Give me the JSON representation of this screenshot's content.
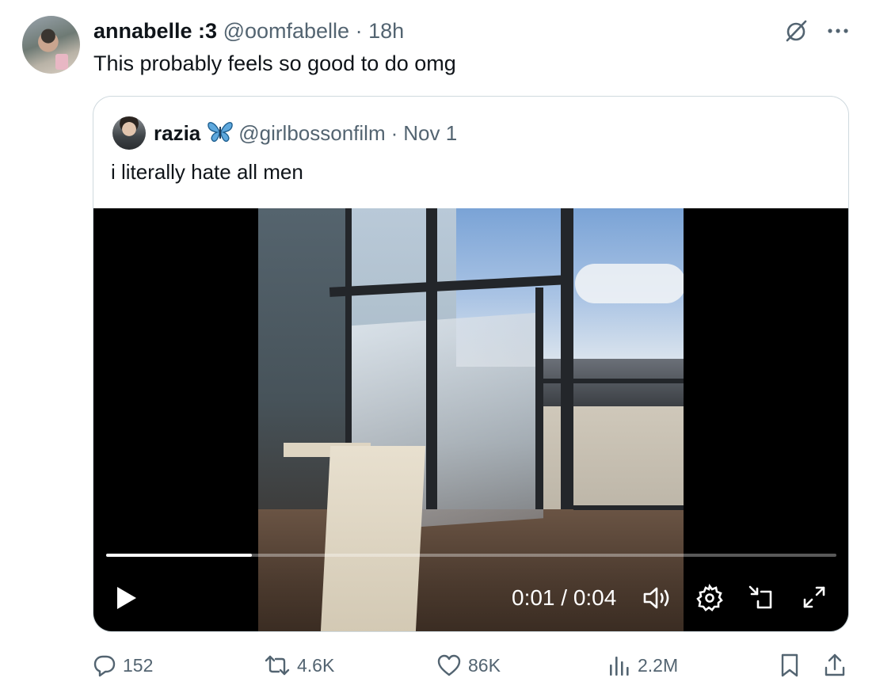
{
  "tweet": {
    "display_name": "annabelle :3",
    "handle": "@oomfabelle",
    "separator": "·",
    "time": "18h",
    "text": "This probably feels so good to do omg"
  },
  "quoted_tweet": {
    "display_name": "razia",
    "badge_emoji_icon": "butterfly-icon",
    "handle": "@girlbossonfilm",
    "separator": "·",
    "date": "Nov 1",
    "text": "i literally hate all men"
  },
  "video": {
    "time_display": "0:01 / 0:04",
    "progress_fraction": 0.2
  },
  "actions": {
    "replies": "152",
    "reposts": "4.6K",
    "likes": "86K",
    "views": "2.2M"
  },
  "colors": {
    "text_primary": "#0f1419",
    "text_muted": "#536471",
    "border": "#cfd9de",
    "butterfly": "#3b88c3"
  }
}
